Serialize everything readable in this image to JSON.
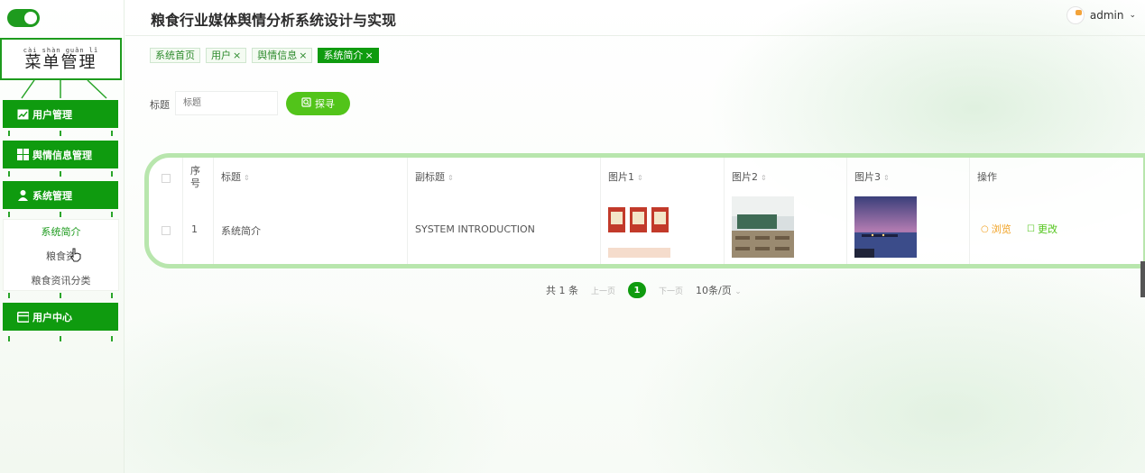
{
  "header": {
    "title": "粮食行业媒体舆情分析系统设计与实现",
    "user": "admin"
  },
  "sidebar": {
    "menu_title_pinyin": "cài  shàn guǎn  lǐ",
    "menu_title": "菜单管理",
    "items": [
      {
        "label": "用户管理",
        "icon": "chart-icon"
      },
      {
        "label": "舆情信息管理",
        "icon": "grid-icon"
      },
      {
        "label": "系统管理",
        "icon": "person-icon"
      },
      {
        "label": "用户中心",
        "icon": "card-icon"
      }
    ],
    "submenu": [
      "系统简介",
      "粮食资",
      "粮食资讯分类"
    ]
  },
  "tabs": [
    {
      "label": "系统首页",
      "closable": ""
    },
    {
      "label": "用户",
      "closable": "×"
    },
    {
      "label": "舆情信息",
      "closable": "×"
    },
    {
      "label": "系统简介",
      "closable": "×"
    }
  ],
  "search": {
    "label": "标题",
    "placeholder": "标题",
    "button": "探寻"
  },
  "table": {
    "headers": [
      "序号",
      "标题",
      "副标题",
      "图片1",
      "图片2",
      "图片3",
      "操作"
    ],
    "rows": [
      {
        "index": "1",
        "title": "系统简介",
        "subtitle": "SYSTEM INTRODUCTION",
        "view": "浏览",
        "edit": "更改"
      }
    ]
  },
  "pagination": {
    "total": "共 1 条",
    "prev": "上一页",
    "page": "1",
    "next": "下一页",
    "size": "10条/页"
  },
  "colors": {
    "primary": "#0f9b0f",
    "accent": "#52c41a",
    "view": "#f0a020"
  }
}
